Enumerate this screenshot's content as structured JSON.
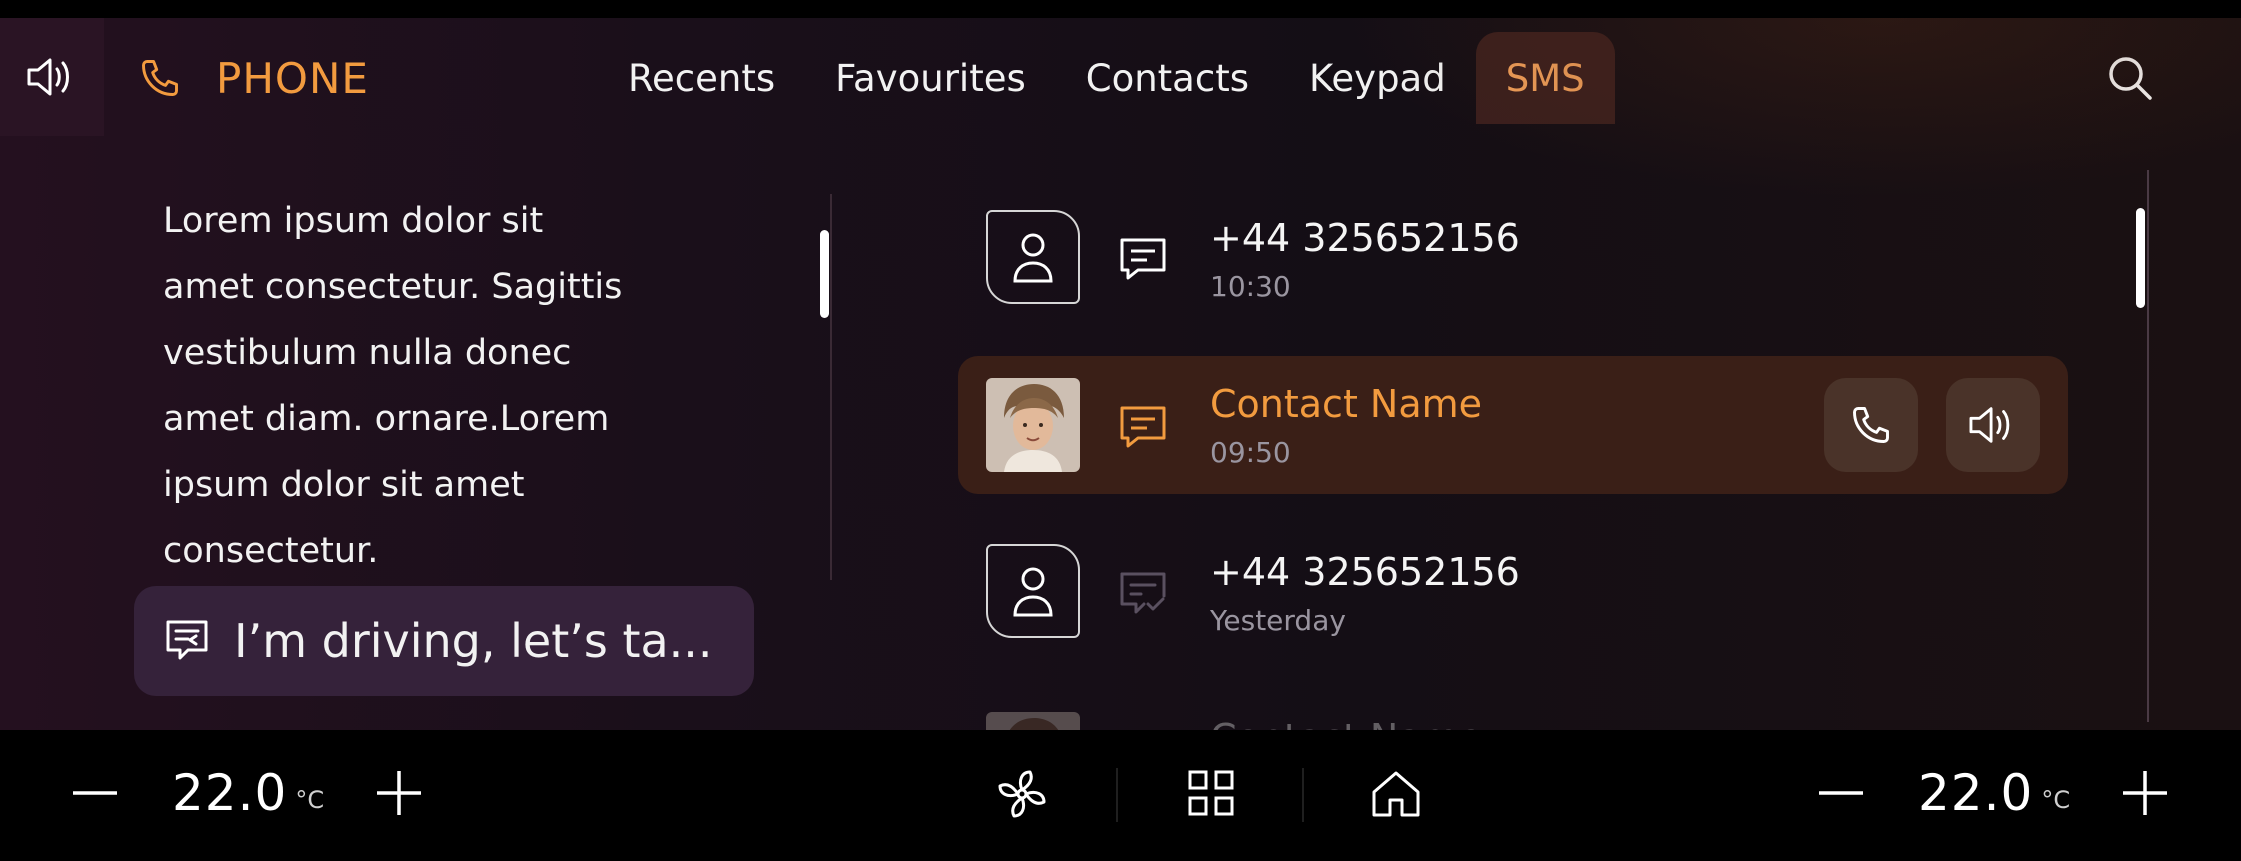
{
  "header": {
    "app_title": "PHONE",
    "tabs": [
      {
        "label": "Recents"
      },
      {
        "label": "Favourites"
      },
      {
        "label": "Contacts"
      },
      {
        "label": "Keypad"
      },
      {
        "label": "SMS",
        "active": true
      }
    ]
  },
  "message": {
    "body_lines": [
      "Lorem ipsum dolor sit",
      "amet consectetur. Sagittis",
      "vestibulum nulla donec",
      "amet diam. ornare.Lorem",
      "ipsum dolor sit amet",
      "consectetur."
    ],
    "quick_reply": "I’m driving, let’s ta..."
  },
  "conversations": [
    {
      "title": "+44 325652156",
      "time": "10:30",
      "avatar": "person-icon",
      "icon": "message-icon"
    },
    {
      "title": "Contact Name",
      "time": "09:50",
      "avatar": "photo",
      "icon": "message-icon",
      "selected": true
    },
    {
      "title": "+44 325652156",
      "time": "Yesterday",
      "avatar": "person-icon",
      "icon": "message-read-icon"
    },
    {
      "title": "Contact Name",
      "time": "",
      "avatar": "photo",
      "icon": "message-icon",
      "faded": true
    }
  ],
  "climate": {
    "left_temp": "22.0",
    "right_temp": "22.0",
    "unit": "°C"
  },
  "colors": {
    "accent": "#f29b3f",
    "selected_row_bg": "#3a1f17",
    "active_tab_bg": "#3b1f1d"
  }
}
